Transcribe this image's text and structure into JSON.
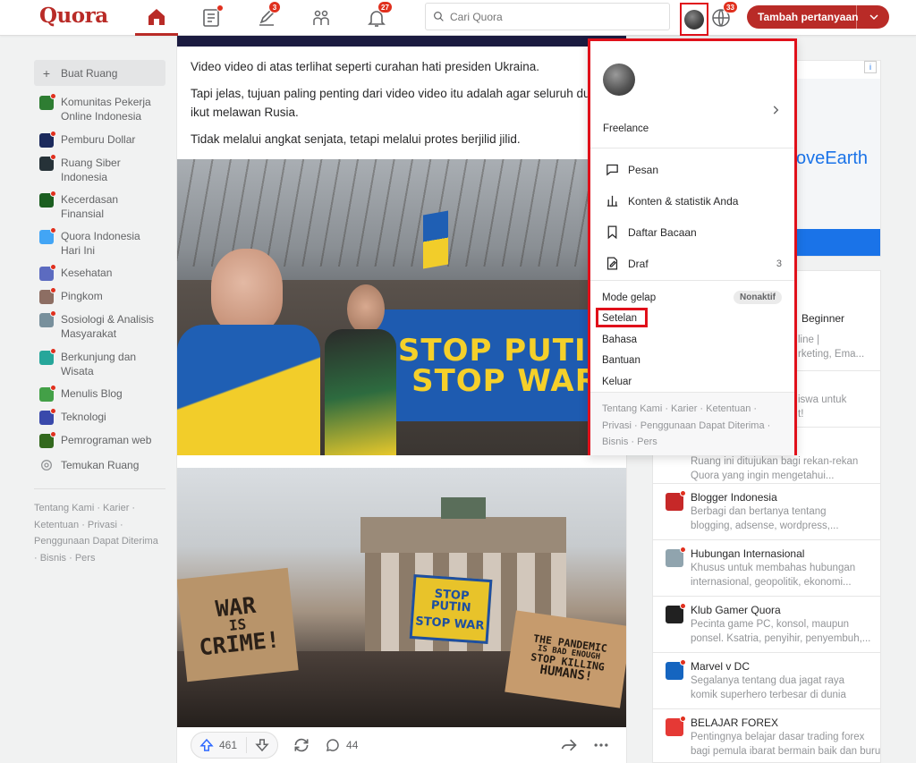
{
  "header": {
    "logo": "Quora",
    "search_placeholder": "Cari Quora",
    "badges": {
      "answer": "3",
      "notifications": "27",
      "languages": "33"
    },
    "add_question": "Tambah pertanyaan"
  },
  "sidebar": {
    "create_label": "Buat Ruang",
    "items": [
      {
        "label": "Komunitas Pekerja Online Indonesia",
        "color": "#2e7d32"
      },
      {
        "label": "Pemburu Dollar",
        "color": "#1b2a5c"
      },
      {
        "label": "Ruang Siber Indonesia",
        "color": "#263238"
      },
      {
        "label": "Kecerdasan Finansial",
        "color": "#1b5e20"
      },
      {
        "label": "Quora Indonesia Hari Ini",
        "color": "#42a5f5"
      },
      {
        "label": "Kesehatan",
        "color": "#5c6bc0"
      },
      {
        "label": "Pingkom",
        "color": "#8d6e63"
      },
      {
        "label": "Sosiologi & Analisis Masyarakat",
        "color": "#78909c"
      },
      {
        "label": "Berkunjung dan Wisata",
        "color": "#26a69a"
      },
      {
        "label": "Menulis Blog",
        "color": "#43a047"
      },
      {
        "label": "Teknologi",
        "color": "#3949ab"
      },
      {
        "label": "Pemrograman web",
        "color": "#33691e"
      }
    ],
    "discover_label": "Temukan Ruang",
    "footer": [
      "Tentang Kami · Karier ·",
      "Ketentuan · Privasi ·",
      "Penggunaan Dapat Diterima",
      "· Bisnis · Pers"
    ]
  },
  "feed": {
    "paragraphs": [
      "Video video di atas terlihat seperti curahan hati presiden Ukraina.",
      "Tapi jelas, tujuan paling penting dari video video itu adalah agar seluruh dunia",
      "ikut melawan Rusia.",
      "Tidak melalui angkat senjata, tetapi melalui protes berjilid jilid."
    ],
    "photo1_banner": [
      "STOP PUTIN",
      "STOP WAR"
    ],
    "photo2_signs": {
      "left": [
        "WAR",
        "IS",
        "CRIME!"
      ],
      "middle": [
        "STOP PUTIN",
        "STOP WAR"
      ],
      "right": [
        "THE PANDEMIC",
        "IS BAD ENOUGH",
        "STOP KILLING",
        "HUMANS!"
      ]
    },
    "upvotes": "461",
    "comments": "44"
  },
  "ad": {
    "text": "oveEarth"
  },
  "spaces": {
    "partial_rows": [
      {
        "name": "Beginner",
        "desc": [
          "line |",
          "rketing, Ema..."
        ]
      },
      {
        "name": "",
        "desc": [
          "iswa untuk",
          "t!"
        ]
      },
      {
        "name": "",
        "desc": [
          "Ruang ini ditujukan bagi rekan-rekan",
          "Quora yang ingin mengetahui..."
        ]
      }
    ],
    "rows": [
      {
        "name": "Blogger Indonesia",
        "desc": [
          "Berbagi dan bertanya tentang",
          "blogging, adsense, wordpress,..."
        ],
        "color": "#c62828"
      },
      {
        "name": "Hubungan Internasional",
        "desc": [
          "Khusus untuk membahas hubungan",
          "internasional, geopolitik, ekonomi..."
        ],
        "color": "#90a4ae"
      },
      {
        "name": "Klub Gamer Quora",
        "desc": [
          "Pecinta game PC, konsol, maupun",
          "ponsel. Ksatria, penyihir, penyembuh,..."
        ],
        "color": "#212121"
      },
      {
        "name": "Marvel v DC",
        "desc": [
          "Segalanya tentang dua jagat raya",
          "komik superhero terbesar di dunia"
        ],
        "color": "#1565c0"
      },
      {
        "name": "BELAJAR FOREX",
        "desc": [
          "Pentingnya belajar dasar trading forex",
          "bagi pemula ibarat bermain baik dan buruk nya"
        ],
        "color": "#e53935"
      }
    ]
  },
  "dropdown": {
    "role": "Freelance",
    "menu": [
      {
        "label": "Pesan",
        "icon": "message-icon",
        "count": ""
      },
      {
        "label": "Konten & statistik Anda",
        "icon": "stats-icon",
        "count": ""
      },
      {
        "label": "Daftar Bacaan",
        "icon": "bookmark-icon",
        "count": ""
      },
      {
        "label": "Draf",
        "icon": "draft-icon",
        "count": "3"
      }
    ],
    "dark_mode": "Mode gelap",
    "dark_mode_state": "Nonaktif",
    "settings": "Setelan",
    "language": "Bahasa",
    "help": "Bantuan",
    "logout": "Keluar",
    "footer": [
      "Tentang Kami · Karier · Ketentuan ·",
      "Privasi · Penggunaan Dapat Diterima ·",
      "Bisnis · Pers"
    ]
  },
  "colors": {
    "brand": "#b92b27",
    "highlight": "#e0101a",
    "badge": "#e0301e"
  }
}
